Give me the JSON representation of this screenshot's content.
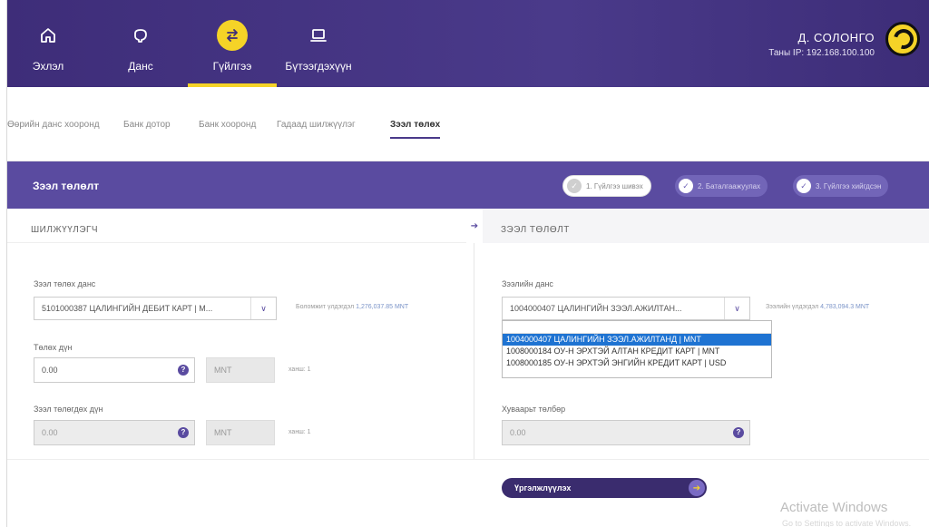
{
  "nav": {
    "items": [
      {
        "label": "Эхлэл",
        "icon": "home-icon"
      },
      {
        "label": "Данс",
        "icon": "piggy-icon"
      },
      {
        "label": "Гүйлгээ",
        "icon": "transfer-icon"
      },
      {
        "label": "Бүтээгдэхүүн",
        "icon": "laptop-icon"
      }
    ],
    "active_index": 2
  },
  "user": {
    "name": "Д. СОЛОНГО",
    "ip": "Таны IP: 192.168.100.100"
  },
  "subtabs": [
    "Өөрийн данс хооронд",
    "Банк дотор",
    "Банк хооронд",
    "Гадаад шилжүүлэг",
    "Зээл төлөх"
  ],
  "panel": {
    "title": "Зээл төлөлт",
    "steps": [
      "1. Гүйлгээ шивэх",
      "2. Баталгаажуулах",
      "3. Гүйлгээ хийгдсэн"
    ]
  },
  "left": {
    "header": "ШИЛЖҮҮЛЭГЧ",
    "pay_account_label": "Зээл төлөх данс",
    "pay_account_value": "5101000387 ЦАЛИНГИЙН ДЕБИТ КАРТ | M...",
    "available_label": "Боломжит үлдэгдэл",
    "available_amount": "1,276,037.85 MNT",
    "amount_label": "Төлөх дүн",
    "amount_value": "0.00",
    "amount_currency": "MNT",
    "rate_label": "ханш: 1",
    "loan_amount_label": "Зээл төлөгдөх дүн",
    "loan_amount_value": "0.00",
    "loan_currency": "MNT",
    "rate_label2": "ханш: 1"
  },
  "right": {
    "header": "ЗЭЭЛ ТӨЛӨЛТ",
    "loan_account_label": "Зээлийн данс",
    "loan_account_value": "1004000407 ЦАЛИНГИЙН ЗЭЭЛ.АЖИЛТАН...",
    "loan_balance_label": "Зээлийн үлдэгдэл",
    "loan_balance_amount": "4,783,094.3 MNT",
    "dropdown_options": [
      "1004000407 ЦАЛИНГИЙН ЗЭЭЛ.АЖИЛТАНД | MNT",
      "1008000184 ОУ-Н ЭРХТЭЙ АЛТАН КРЕДИТ КАРТ | MNT",
      "1008000185 ОУ-Н ЭРХТЭЙ ЭНГИЙН КРЕДИТ КАРТ | USD"
    ],
    "selected_option_index": 0,
    "schedule_label": "Хуваарьт төлбөр",
    "schedule_value": "0.00"
  },
  "continue_label": "Үргэлжлүүлэх",
  "watermark": {
    "title": "Activate Windows",
    "sub": "Go to Settings to activate Windows."
  },
  "colors": {
    "nav_bg": "#3e2d79",
    "accent_yellow": "#f5d327",
    "panel_purple": "#5a4ba0",
    "select_blue": "#1e73d2"
  }
}
